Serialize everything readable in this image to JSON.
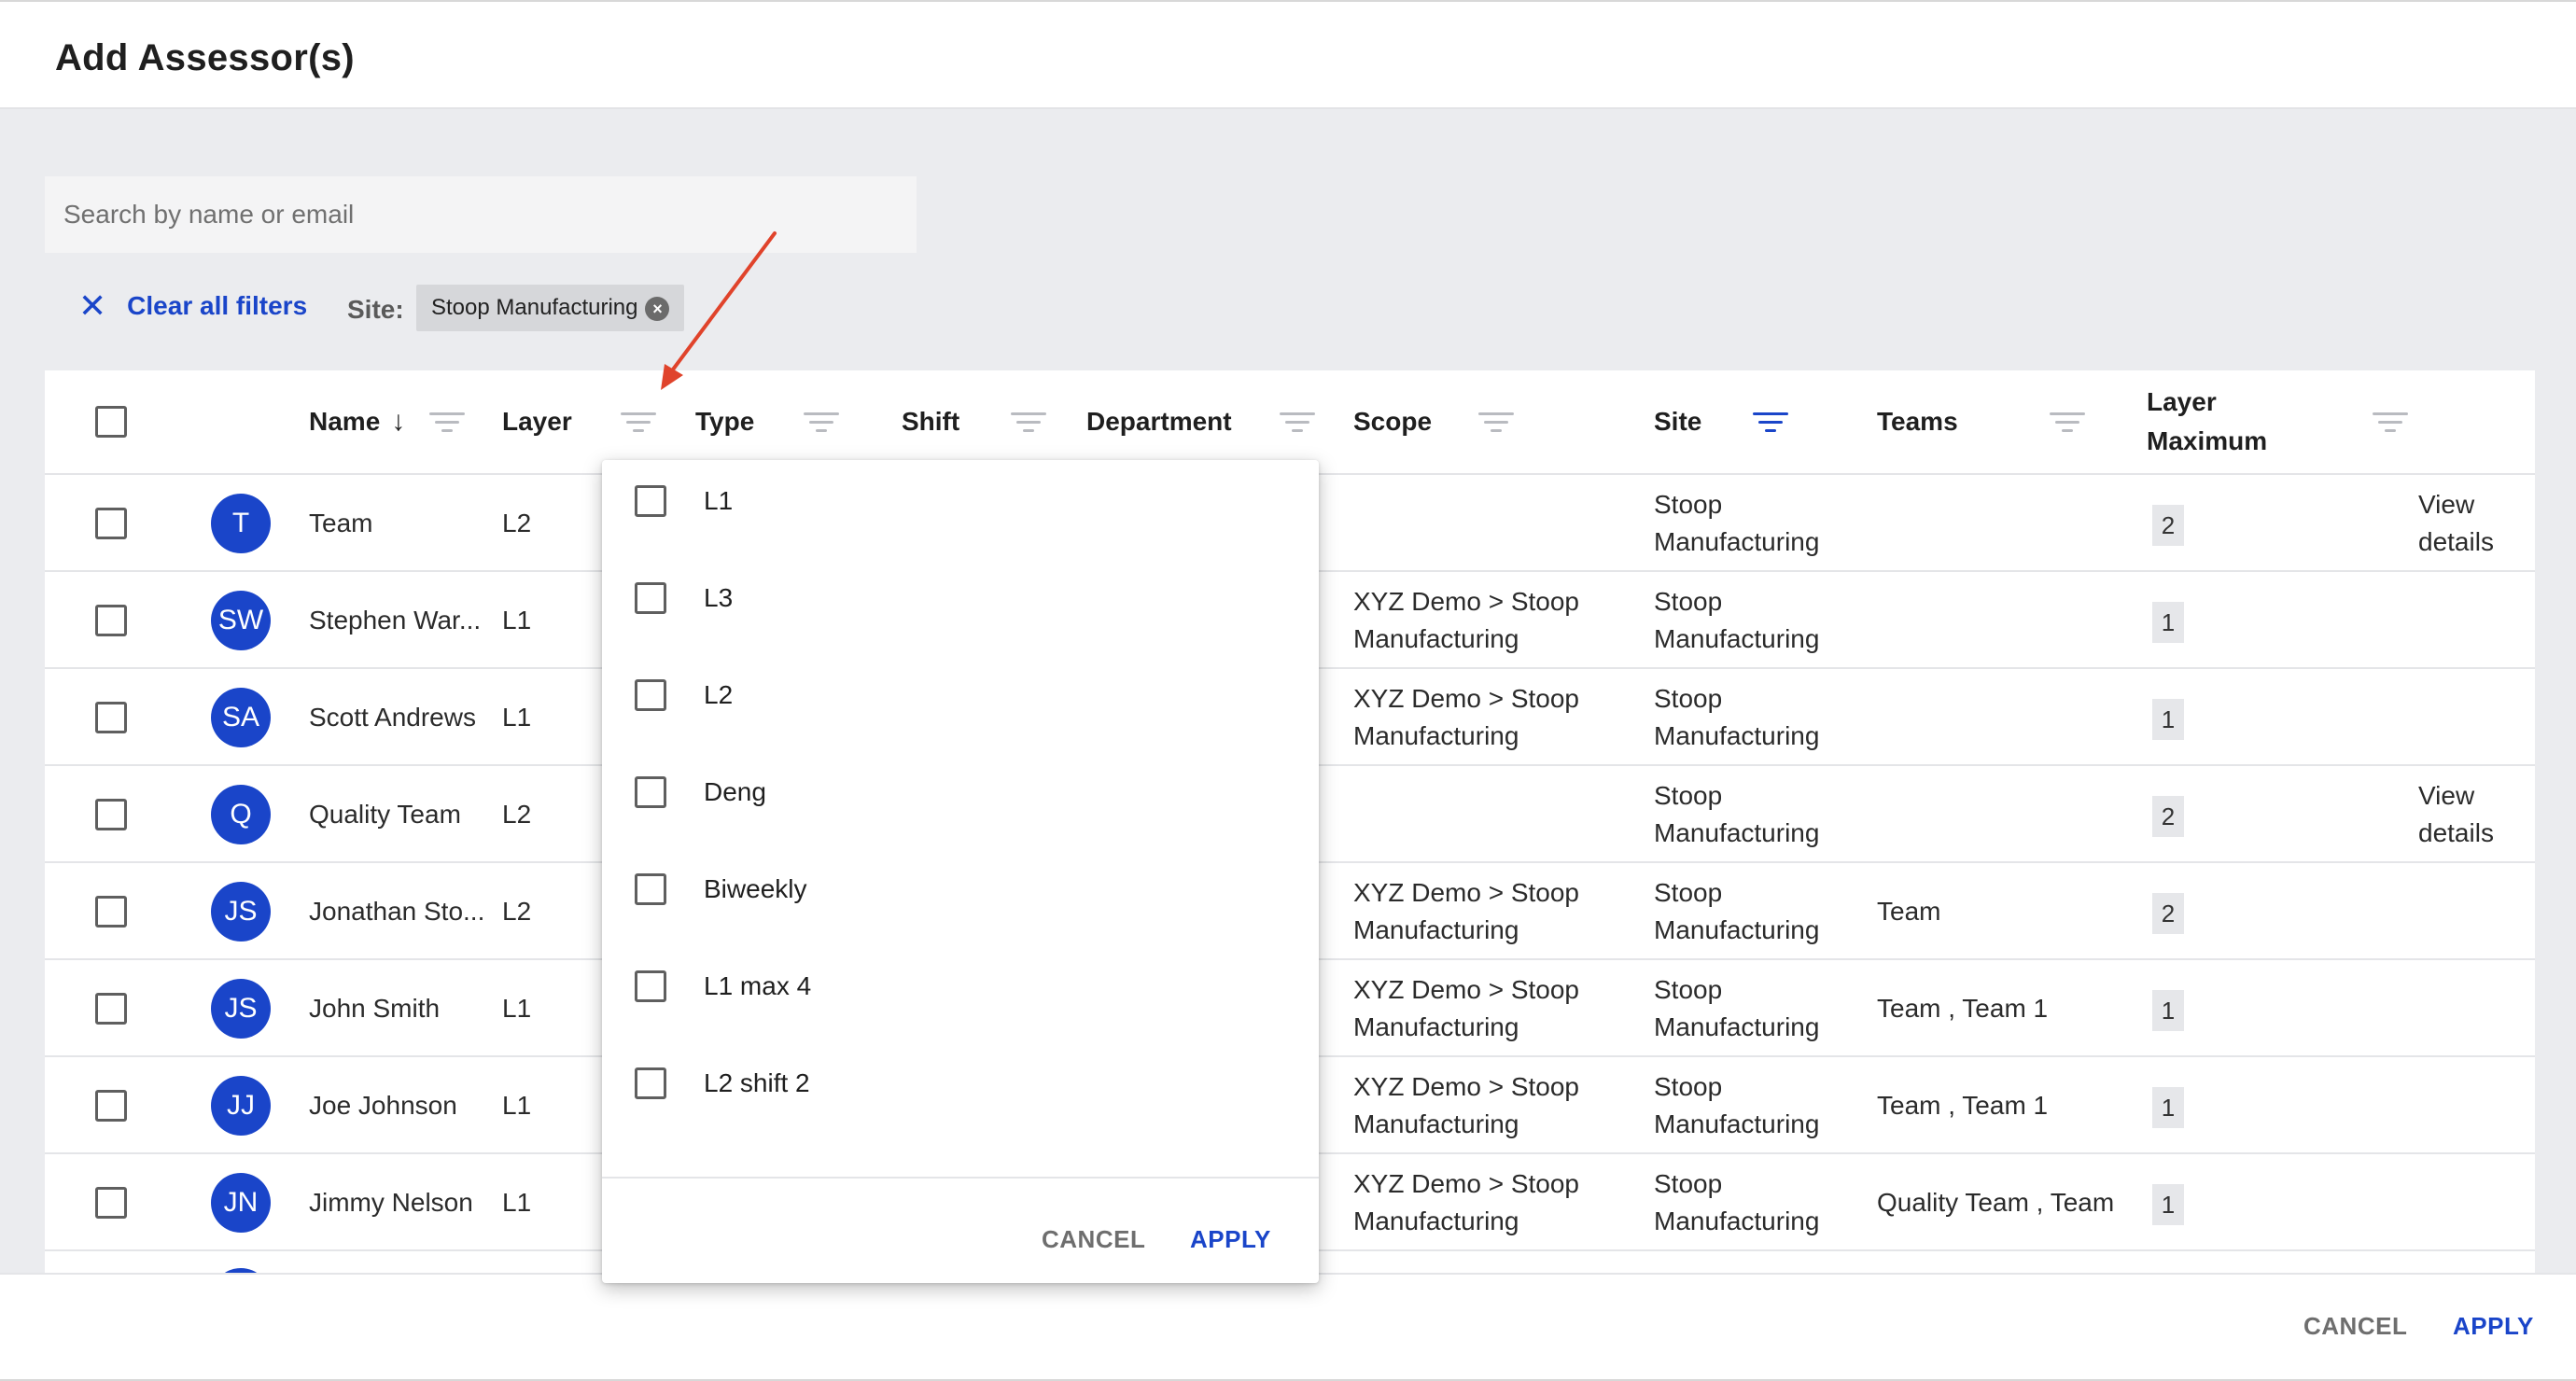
{
  "dialog": {
    "title": "Add Assessor(s)"
  },
  "search": {
    "placeholder": "Search by name or email"
  },
  "filters": {
    "clear_label": "Clear all filters",
    "site_label": "Site:",
    "site_chip": "Stoop Manufacturing"
  },
  "table": {
    "headers": {
      "name": "Name",
      "layer": "Layer",
      "type": "Type",
      "shift": "Shift",
      "department": "Department",
      "scope": "Scope",
      "site": "Site",
      "teams": "Teams",
      "layer_max_1": "Layer",
      "layer_max_2": "Maximum"
    },
    "rows": [
      {
        "initials": "T",
        "name": "Team",
        "layer": "L2",
        "scope1": "",
        "scope2": "",
        "site1": "Stoop",
        "site2": "Manufacturing",
        "teams": "",
        "max": "2",
        "action1": "View",
        "action2": "details"
      },
      {
        "initials": "SW",
        "name": "Stephen War...",
        "layer": "L1",
        "scope1": "XYZ Demo > Stoop",
        "scope2": "Manufacturing",
        "site1": "Stoop",
        "site2": "Manufacturing",
        "teams": "",
        "max": "1",
        "action1": "",
        "action2": ""
      },
      {
        "initials": "SA",
        "name": "Scott Andrews",
        "layer": "L1",
        "scope1": "XYZ Demo > Stoop",
        "scope2": "Manufacturing",
        "site1": "Stoop",
        "site2": "Manufacturing",
        "teams": "",
        "max": "1",
        "action1": "",
        "action2": ""
      },
      {
        "initials": "Q",
        "name": "Quality Team",
        "layer": "L2",
        "scope1": "",
        "scope2": "",
        "site1": "Stoop",
        "site2": "Manufacturing",
        "teams": "",
        "max": "2",
        "action1": "View",
        "action2": "details"
      },
      {
        "initials": "JS",
        "name": "Jonathan Sto...",
        "layer": "L2",
        "scope1": "XYZ Demo > Stoop",
        "scope2": "Manufacturing",
        "site1": "Stoop",
        "site2": "Manufacturing",
        "teams": "Team",
        "max": "2",
        "action1": "",
        "action2": ""
      },
      {
        "initials": "JS",
        "name": "John Smith",
        "layer": "L1",
        "scope1": "XYZ Demo > Stoop",
        "scope2": "Manufacturing",
        "site1": "Stoop",
        "site2": "Manufacturing",
        "teams": "Team , Team 1",
        "max": "1",
        "action1": "",
        "action2": ""
      },
      {
        "initials": "JJ",
        "name": "Joe Johnson",
        "layer": "L1",
        "scope1": "XYZ Demo > Stoop",
        "scope2": "Manufacturing",
        "site1": "Stoop",
        "site2": "Manufacturing",
        "teams": "Team , Team 1",
        "max": "1",
        "action1": "",
        "action2": ""
      },
      {
        "initials": "JN",
        "name": "Jimmy Nelson",
        "layer": "L1",
        "scope1": "XYZ Demo > Stoop",
        "scope2": "Manufacturing",
        "site1": "Stoop",
        "site2": "Manufacturing",
        "teams": "Quality Team , Team",
        "max": "1",
        "action1": "",
        "action2": ""
      }
    ]
  },
  "layer_filter_dropdown": {
    "options": [
      "L1",
      "L3",
      "L2",
      "Deng",
      "Biweekly",
      "L1 max 4",
      "L2 shift 2"
    ],
    "cancel_label": "CANCEL",
    "apply_label": "APPLY"
  },
  "footer": {
    "cancel_label": "CANCEL",
    "apply_label": "APPLY"
  },
  "colors": {
    "accent": "#1a45c9",
    "annotation_arrow": "#e0432b",
    "background": "#ebecef"
  },
  "icons": [
    "close-icon",
    "sort-down-arrow-icon",
    "filter-icon",
    "chip-remove-icon",
    "annotation-arrow"
  ]
}
